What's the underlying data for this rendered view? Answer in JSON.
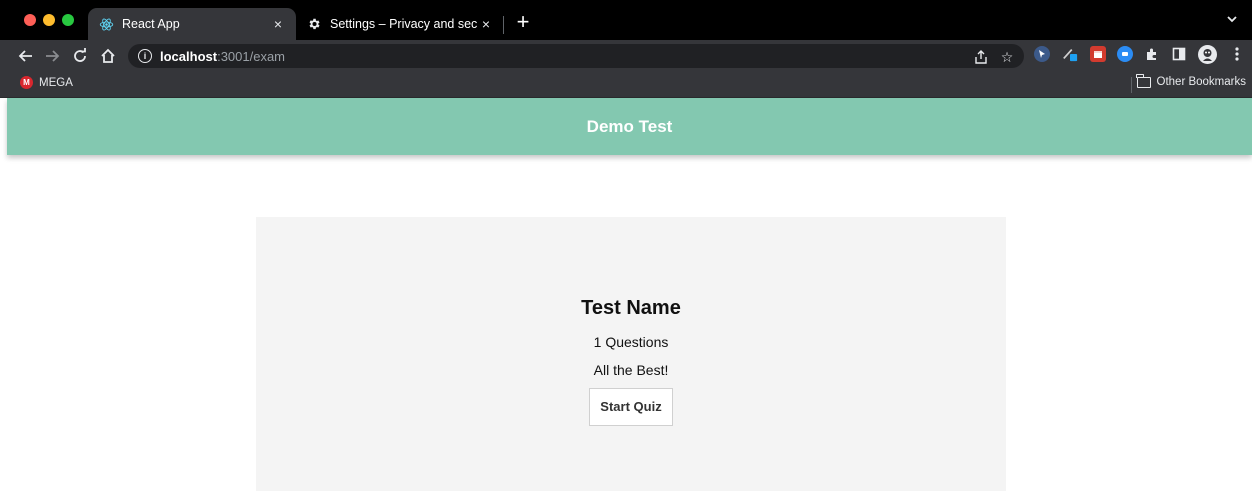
{
  "browser": {
    "tabs": [
      {
        "title": "React App",
        "icon": "react-icon",
        "active": true
      },
      {
        "title": "Settings – Privacy and security",
        "icon": "gear-icon",
        "active": false
      }
    ],
    "new_tab_label": "+",
    "tab_close_glyph": "×",
    "address": {
      "host": "localhost",
      "path": ":3001/exam"
    },
    "bookmarks": [
      {
        "label": "MEGA",
        "icon": "mega-icon"
      },
      {
        "label": "Other Bookmarks",
        "icon": "folder-icon"
      }
    ],
    "mega_badge": "M",
    "colors": {
      "tabstrip": "#000000",
      "toolbar": "#35363a",
      "omnibox": "#202124"
    }
  },
  "app": {
    "header_title": "Demo Test",
    "header_color": "#83c8b0",
    "quiz": {
      "name": "Test Name",
      "questions_text": "1 Questions",
      "greeting": "All the Best!",
      "start_label": "Start Quiz"
    }
  }
}
